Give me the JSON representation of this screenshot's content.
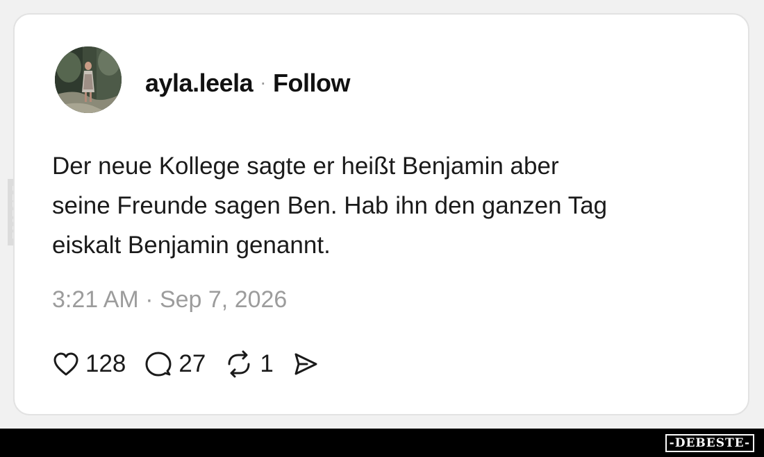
{
  "post": {
    "username": "ayla.leela",
    "separator": "·",
    "follow_label": "Follow",
    "text_lines": [
      "Der neue Kollege sagte er heißt Benjamin aber",
      "seine Freunde sagen Ben. Hab ihn den ganzen Tag",
      "eiskalt Benjamin genannt."
    ],
    "timestamp": "3:21 AM · Sep 7, 2026",
    "likes": "128",
    "replies": "27",
    "reposts": "1"
  },
  "icons": {
    "like": "heart-icon",
    "reply": "speech-bubble-icon",
    "repost": "repost-arrows-icon",
    "share": "send-icon"
  },
  "watermark": {
    "side": "DEBESTE",
    "logo": "-DEBESTE-"
  },
  "colors": {
    "card_bg": "#ffffff",
    "card_border": "#e2e2e2",
    "text": "#1a1a1a",
    "muted": "#9c9c9c",
    "footer_bar": "#000000"
  }
}
